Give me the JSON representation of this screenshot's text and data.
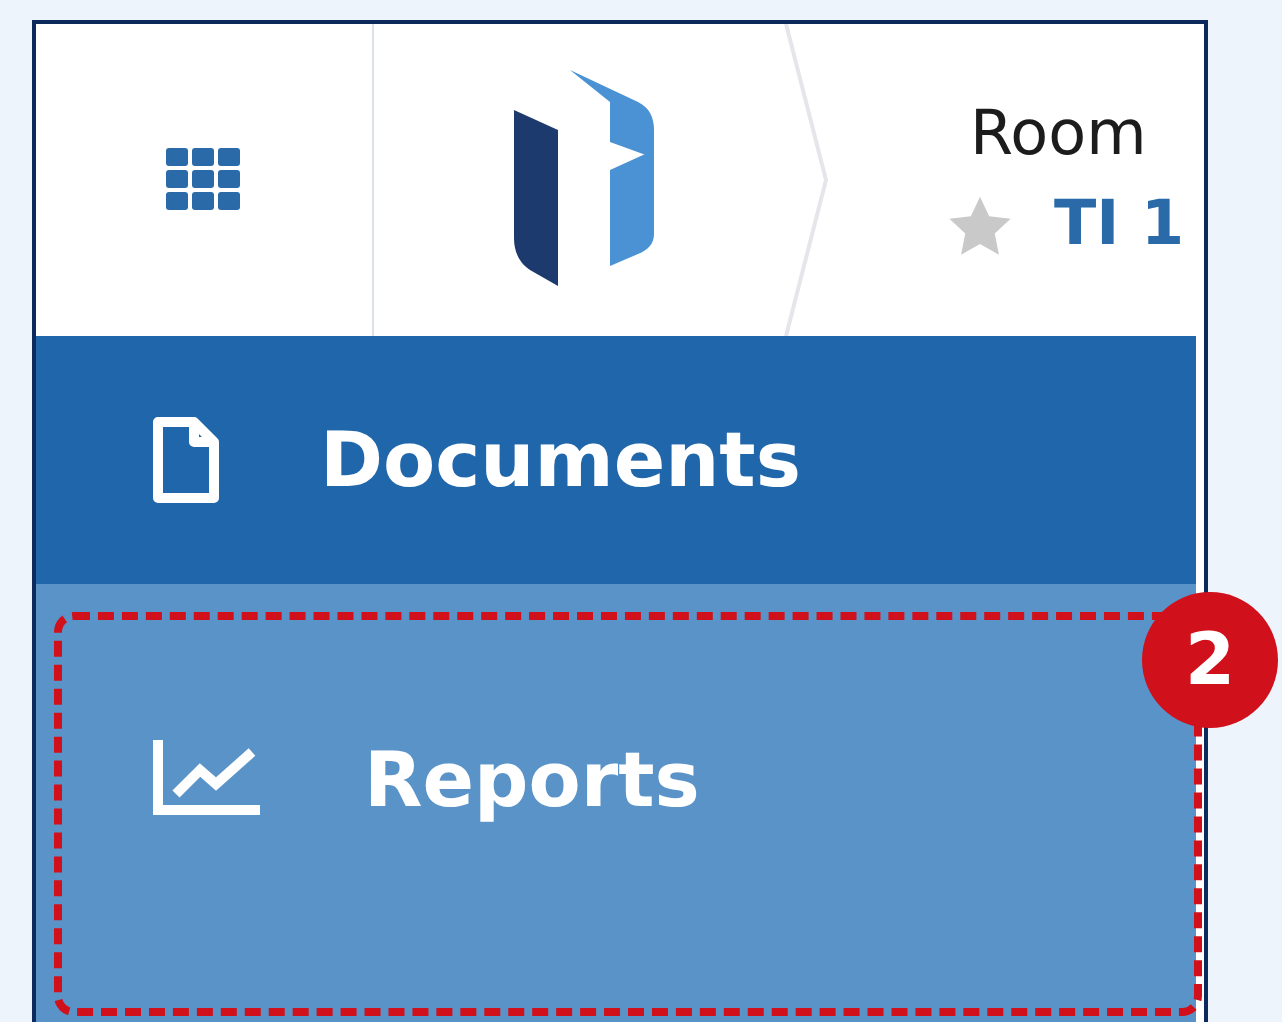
{
  "header": {
    "title": "Room",
    "subtitle": "TI 1",
    "starred": false
  },
  "nav_items": [
    {
      "label": "Documents",
      "kind": "document",
      "selected": true
    },
    {
      "label": "Reports",
      "kind": "chart",
      "selected": false
    }
  ],
  "callout": {
    "number": "2"
  }
}
